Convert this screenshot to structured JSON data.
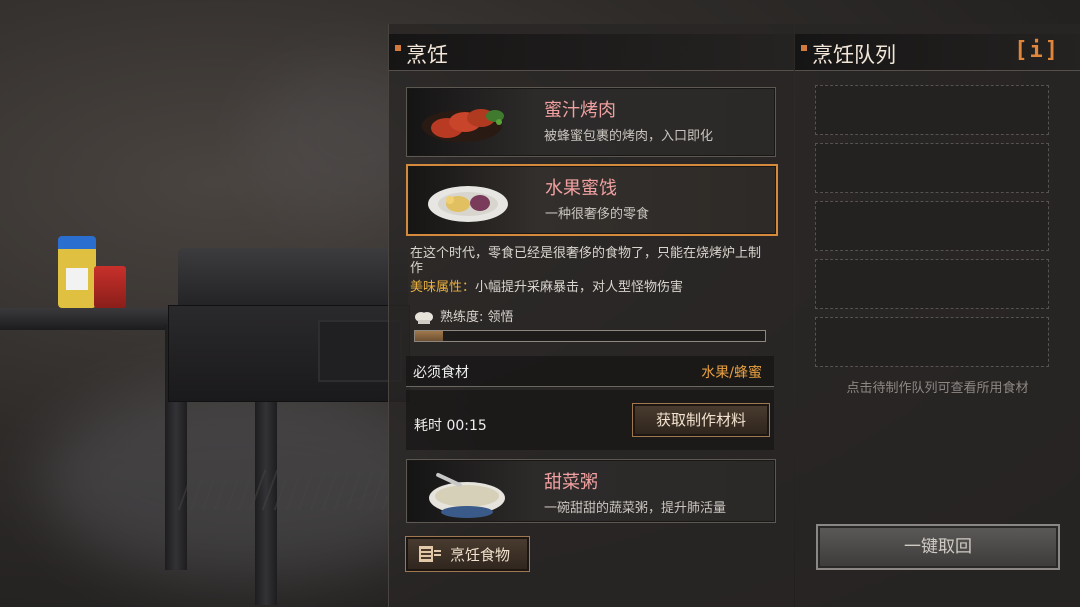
{
  "left_panel": {
    "title": "烹饪"
  },
  "right_panel": {
    "title": "烹饪队列",
    "info_label": "[i]"
  },
  "recipes": [
    {
      "name": "蜜汁烤肉",
      "desc": "被蜂蜜包裹的烤肉，入口即化",
      "image": "roast-meat-image",
      "selected": false
    },
    {
      "name": "水果蜜饯",
      "desc": "一种很奢侈的零食",
      "image": "candied-fruit-image",
      "selected": true
    },
    {
      "name": "甜菜粥",
      "desc": "一碗甜甜的蔬菜粥，提升肺活量",
      "image": "vegetable-porridge-image",
      "selected": false
    }
  ],
  "detail": {
    "description": "在这个时代，零食已经是很奢侈的食物了，只能在烧烤炉上制作",
    "attribute_label": "美味属性：",
    "attribute_text": "小幅提升采麻暴击，对人型怪物伤害",
    "proficiency": "熟练度: 领悟",
    "proficiency_progress": 0.08,
    "ingredients_label": "必须食材",
    "ingredients_value": "水果/蜂蜜",
    "time": "耗时 00:15",
    "get_materials_label": "获取制作材料"
  },
  "cook_button": {
    "label": "烹饪食物"
  },
  "queue": {
    "slots": 5,
    "hint": "点击待制作队列可查看所用食材",
    "retrieve_label": "一键取回"
  },
  "colors": {
    "accent": "#d48a3c",
    "dish_name": "#f0a0a0",
    "highlight": "#e8a040"
  }
}
